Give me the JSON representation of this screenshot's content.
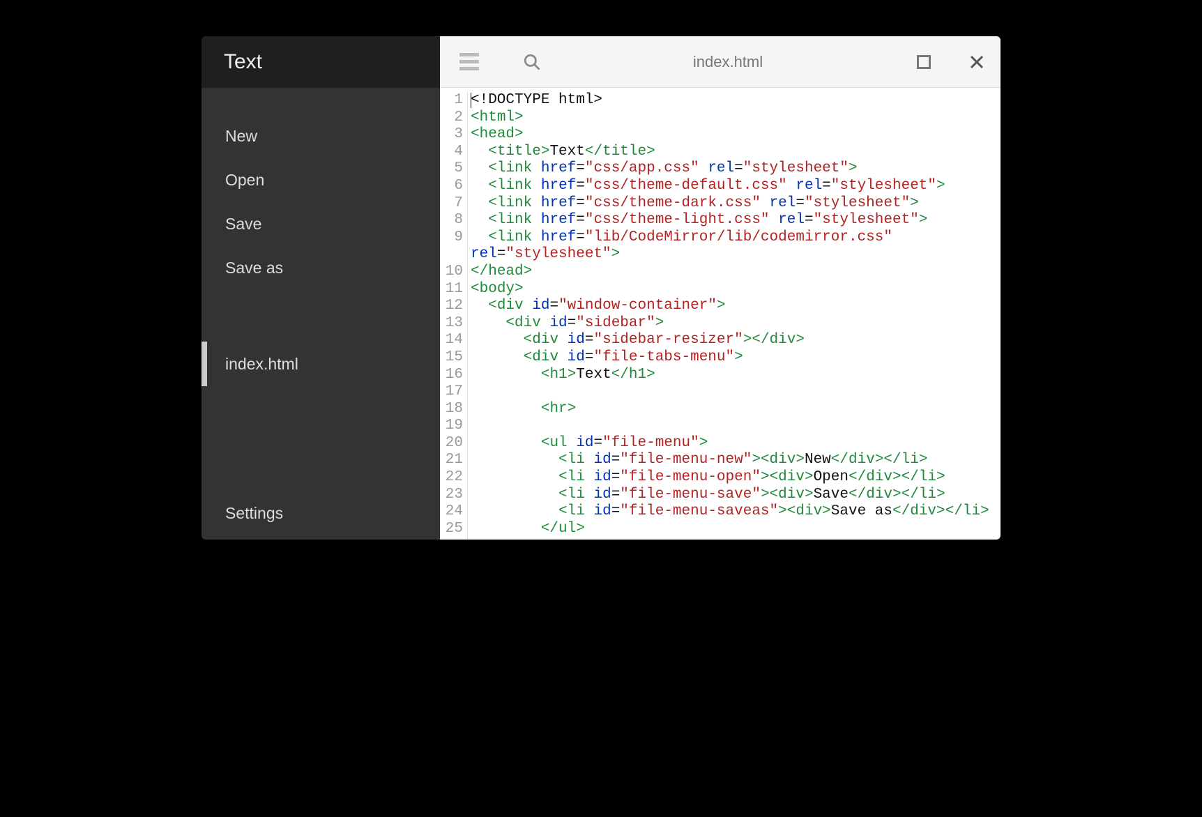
{
  "sidebar": {
    "title": "Text",
    "menu": {
      "new": "New",
      "open": "Open",
      "save": "Save",
      "saveas": "Save as"
    },
    "tabs": [
      {
        "name": "index.html",
        "active": true
      }
    ],
    "settings": "Settings"
  },
  "toolbar": {
    "filename": "index.html"
  },
  "code": {
    "lines": [
      1,
      2,
      3,
      4,
      5,
      6,
      7,
      8,
      9,
      10,
      11,
      12,
      13,
      14,
      15,
      16,
      17,
      18,
      19,
      20,
      21,
      22,
      23,
      24,
      25
    ],
    "tokens": [
      [
        {
          "t": "plain",
          "v": "<!DOCTYPE html>"
        }
      ],
      [
        {
          "t": "angle",
          "v": "<"
        },
        {
          "t": "tag",
          "v": "html"
        },
        {
          "t": "angle",
          "v": ">"
        }
      ],
      [
        {
          "t": "angle",
          "v": "<"
        },
        {
          "t": "tag",
          "v": "head"
        },
        {
          "t": "angle",
          "v": ">"
        }
      ],
      [
        {
          "t": "plain",
          "v": "  "
        },
        {
          "t": "angle",
          "v": "<"
        },
        {
          "t": "tag",
          "v": "title"
        },
        {
          "t": "angle",
          "v": ">"
        },
        {
          "t": "plain",
          "v": "Text"
        },
        {
          "t": "angle",
          "v": "</"
        },
        {
          "t": "tag",
          "v": "title"
        },
        {
          "t": "angle",
          "v": ">"
        }
      ],
      [
        {
          "t": "plain",
          "v": "  "
        },
        {
          "t": "angle",
          "v": "<"
        },
        {
          "t": "tag",
          "v": "link"
        },
        {
          "t": "plain",
          "v": " "
        },
        {
          "t": "attr",
          "v": "href"
        },
        {
          "t": "plain",
          "v": "="
        },
        {
          "t": "string",
          "v": "\"css/app.css\""
        },
        {
          "t": "plain",
          "v": " "
        },
        {
          "t": "attr",
          "v": "rel"
        },
        {
          "t": "plain",
          "v": "="
        },
        {
          "t": "string",
          "v": "\"stylesheet\""
        },
        {
          "t": "angle",
          "v": ">"
        }
      ],
      [
        {
          "t": "plain",
          "v": "  "
        },
        {
          "t": "angle",
          "v": "<"
        },
        {
          "t": "tag",
          "v": "link"
        },
        {
          "t": "plain",
          "v": " "
        },
        {
          "t": "attr",
          "v": "href"
        },
        {
          "t": "plain",
          "v": "="
        },
        {
          "t": "string",
          "v": "\"css/theme-default.css\""
        },
        {
          "t": "plain",
          "v": " "
        },
        {
          "t": "attr",
          "v": "rel"
        },
        {
          "t": "plain",
          "v": "="
        },
        {
          "t": "string",
          "v": "\"stylesheet\""
        },
        {
          "t": "angle",
          "v": ">"
        }
      ],
      [
        {
          "t": "plain",
          "v": "  "
        },
        {
          "t": "angle",
          "v": "<"
        },
        {
          "t": "tag",
          "v": "link"
        },
        {
          "t": "plain",
          "v": " "
        },
        {
          "t": "attr",
          "v": "href"
        },
        {
          "t": "plain",
          "v": "="
        },
        {
          "t": "string",
          "v": "\"css/theme-dark.css\""
        },
        {
          "t": "plain",
          "v": " "
        },
        {
          "t": "attr",
          "v": "rel"
        },
        {
          "t": "plain",
          "v": "="
        },
        {
          "t": "string",
          "v": "\"stylesheet\""
        },
        {
          "t": "angle",
          "v": ">"
        }
      ],
      [
        {
          "t": "plain",
          "v": "  "
        },
        {
          "t": "angle",
          "v": "<"
        },
        {
          "t": "tag",
          "v": "link"
        },
        {
          "t": "plain",
          "v": " "
        },
        {
          "t": "attr",
          "v": "href"
        },
        {
          "t": "plain",
          "v": "="
        },
        {
          "t": "string",
          "v": "\"css/theme-light.css\""
        },
        {
          "t": "plain",
          "v": " "
        },
        {
          "t": "attr",
          "v": "rel"
        },
        {
          "t": "plain",
          "v": "="
        },
        {
          "t": "string",
          "v": "\"stylesheet\""
        },
        {
          "t": "angle",
          "v": ">"
        }
      ],
      [
        {
          "t": "plain",
          "v": "  "
        },
        {
          "t": "angle",
          "v": "<"
        },
        {
          "t": "tag",
          "v": "link"
        },
        {
          "t": "plain",
          "v": " "
        },
        {
          "t": "attr",
          "v": "href"
        },
        {
          "t": "plain",
          "v": "="
        },
        {
          "t": "string",
          "v": "\"lib/CodeMirror/lib/codemirror.css\""
        },
        {
          "t": "plain",
          "v": "\n"
        },
        {
          "t": "attr",
          "v": "rel"
        },
        {
          "t": "plain",
          "v": "="
        },
        {
          "t": "string",
          "v": "\"stylesheet\""
        },
        {
          "t": "angle",
          "v": ">"
        }
      ],
      [
        {
          "t": "angle",
          "v": "</"
        },
        {
          "t": "tag",
          "v": "head"
        },
        {
          "t": "angle",
          "v": ">"
        }
      ],
      [
        {
          "t": "angle",
          "v": "<"
        },
        {
          "t": "tag",
          "v": "body"
        },
        {
          "t": "angle",
          "v": ">"
        }
      ],
      [
        {
          "t": "plain",
          "v": "  "
        },
        {
          "t": "angle",
          "v": "<"
        },
        {
          "t": "tag",
          "v": "div"
        },
        {
          "t": "plain",
          "v": " "
        },
        {
          "t": "attr",
          "v": "id"
        },
        {
          "t": "plain",
          "v": "="
        },
        {
          "t": "string",
          "v": "\"window-container\""
        },
        {
          "t": "angle",
          "v": ">"
        }
      ],
      [
        {
          "t": "plain",
          "v": "    "
        },
        {
          "t": "angle",
          "v": "<"
        },
        {
          "t": "tag",
          "v": "div"
        },
        {
          "t": "plain",
          "v": " "
        },
        {
          "t": "attr",
          "v": "id"
        },
        {
          "t": "plain",
          "v": "="
        },
        {
          "t": "string",
          "v": "\"sidebar\""
        },
        {
          "t": "angle",
          "v": ">"
        }
      ],
      [
        {
          "t": "plain",
          "v": "      "
        },
        {
          "t": "angle",
          "v": "<"
        },
        {
          "t": "tag",
          "v": "div"
        },
        {
          "t": "plain",
          "v": " "
        },
        {
          "t": "attr",
          "v": "id"
        },
        {
          "t": "plain",
          "v": "="
        },
        {
          "t": "string",
          "v": "\"sidebar-resizer\""
        },
        {
          "t": "angle",
          "v": ">"
        },
        {
          "t": "angle",
          "v": "</"
        },
        {
          "t": "tag",
          "v": "div"
        },
        {
          "t": "angle",
          "v": ">"
        }
      ],
      [
        {
          "t": "plain",
          "v": "      "
        },
        {
          "t": "angle",
          "v": "<"
        },
        {
          "t": "tag",
          "v": "div"
        },
        {
          "t": "plain",
          "v": " "
        },
        {
          "t": "attr",
          "v": "id"
        },
        {
          "t": "plain",
          "v": "="
        },
        {
          "t": "string",
          "v": "\"file-tabs-menu\""
        },
        {
          "t": "angle",
          "v": ">"
        }
      ],
      [
        {
          "t": "plain",
          "v": "        "
        },
        {
          "t": "angle",
          "v": "<"
        },
        {
          "t": "tag",
          "v": "h1"
        },
        {
          "t": "angle",
          "v": ">"
        },
        {
          "t": "plain",
          "v": "Text"
        },
        {
          "t": "angle",
          "v": "</"
        },
        {
          "t": "tag",
          "v": "h1"
        },
        {
          "t": "angle",
          "v": ">"
        }
      ],
      [],
      [
        {
          "t": "plain",
          "v": "        "
        },
        {
          "t": "angle",
          "v": "<"
        },
        {
          "t": "tag",
          "v": "hr"
        },
        {
          "t": "angle",
          "v": ">"
        }
      ],
      [],
      [
        {
          "t": "plain",
          "v": "        "
        },
        {
          "t": "angle",
          "v": "<"
        },
        {
          "t": "tag",
          "v": "ul"
        },
        {
          "t": "plain",
          "v": " "
        },
        {
          "t": "attr",
          "v": "id"
        },
        {
          "t": "plain",
          "v": "="
        },
        {
          "t": "string",
          "v": "\"file-menu\""
        },
        {
          "t": "angle",
          "v": ">"
        }
      ],
      [
        {
          "t": "plain",
          "v": "          "
        },
        {
          "t": "angle",
          "v": "<"
        },
        {
          "t": "tag",
          "v": "li"
        },
        {
          "t": "plain",
          "v": " "
        },
        {
          "t": "attr",
          "v": "id"
        },
        {
          "t": "plain",
          "v": "="
        },
        {
          "t": "string",
          "v": "\"file-menu-new\""
        },
        {
          "t": "angle",
          "v": ">"
        },
        {
          "t": "angle",
          "v": "<"
        },
        {
          "t": "tag",
          "v": "div"
        },
        {
          "t": "angle",
          "v": ">"
        },
        {
          "t": "plain",
          "v": "New"
        },
        {
          "t": "angle",
          "v": "</"
        },
        {
          "t": "tag",
          "v": "div"
        },
        {
          "t": "angle",
          "v": ">"
        },
        {
          "t": "angle",
          "v": "</"
        },
        {
          "t": "tag",
          "v": "li"
        },
        {
          "t": "angle",
          "v": ">"
        }
      ],
      [
        {
          "t": "plain",
          "v": "          "
        },
        {
          "t": "angle",
          "v": "<"
        },
        {
          "t": "tag",
          "v": "li"
        },
        {
          "t": "plain",
          "v": " "
        },
        {
          "t": "attr",
          "v": "id"
        },
        {
          "t": "plain",
          "v": "="
        },
        {
          "t": "string",
          "v": "\"file-menu-open\""
        },
        {
          "t": "angle",
          "v": ">"
        },
        {
          "t": "angle",
          "v": "<"
        },
        {
          "t": "tag",
          "v": "div"
        },
        {
          "t": "angle",
          "v": ">"
        },
        {
          "t": "plain",
          "v": "Open"
        },
        {
          "t": "angle",
          "v": "</"
        },
        {
          "t": "tag",
          "v": "div"
        },
        {
          "t": "angle",
          "v": ">"
        },
        {
          "t": "angle",
          "v": "</"
        },
        {
          "t": "tag",
          "v": "li"
        },
        {
          "t": "angle",
          "v": ">"
        }
      ],
      [
        {
          "t": "plain",
          "v": "          "
        },
        {
          "t": "angle",
          "v": "<"
        },
        {
          "t": "tag",
          "v": "li"
        },
        {
          "t": "plain",
          "v": " "
        },
        {
          "t": "attr",
          "v": "id"
        },
        {
          "t": "plain",
          "v": "="
        },
        {
          "t": "string",
          "v": "\"file-menu-save\""
        },
        {
          "t": "angle",
          "v": ">"
        },
        {
          "t": "angle",
          "v": "<"
        },
        {
          "t": "tag",
          "v": "div"
        },
        {
          "t": "angle",
          "v": ">"
        },
        {
          "t": "plain",
          "v": "Save"
        },
        {
          "t": "angle",
          "v": "</"
        },
        {
          "t": "tag",
          "v": "div"
        },
        {
          "t": "angle",
          "v": ">"
        },
        {
          "t": "angle",
          "v": "</"
        },
        {
          "t": "tag",
          "v": "li"
        },
        {
          "t": "angle",
          "v": ">"
        }
      ],
      [
        {
          "t": "plain",
          "v": "          "
        },
        {
          "t": "angle",
          "v": "<"
        },
        {
          "t": "tag",
          "v": "li"
        },
        {
          "t": "plain",
          "v": " "
        },
        {
          "t": "attr",
          "v": "id"
        },
        {
          "t": "plain",
          "v": "="
        },
        {
          "t": "string",
          "v": "\"file-menu-saveas\""
        },
        {
          "t": "angle",
          "v": ">"
        },
        {
          "t": "angle",
          "v": "<"
        },
        {
          "t": "tag",
          "v": "div"
        },
        {
          "t": "angle",
          "v": ">"
        },
        {
          "t": "plain",
          "v": "Save as"
        },
        {
          "t": "angle",
          "v": "</"
        },
        {
          "t": "tag",
          "v": "div"
        },
        {
          "t": "angle",
          "v": ">"
        },
        {
          "t": "angle",
          "v": "</"
        },
        {
          "t": "tag",
          "v": "li"
        },
        {
          "t": "angle",
          "v": ">"
        }
      ],
      [
        {
          "t": "plain",
          "v": "        "
        },
        {
          "t": "angle",
          "v": "</"
        },
        {
          "t": "tag",
          "v": "ul"
        },
        {
          "t": "angle",
          "v": ">"
        }
      ]
    ]
  }
}
